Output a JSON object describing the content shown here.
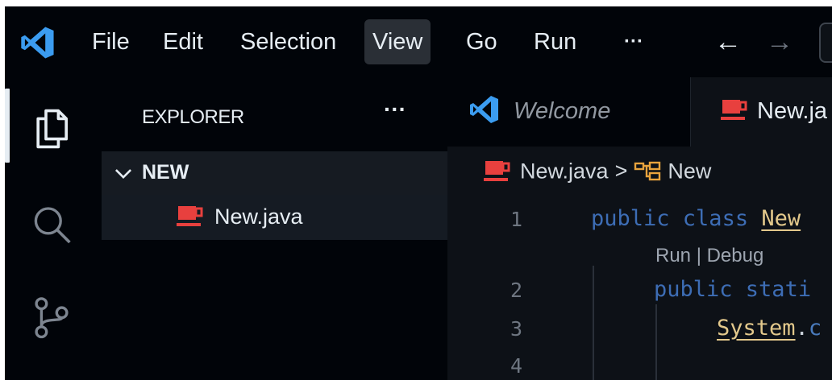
{
  "menu": {
    "items": [
      "File",
      "Edit",
      "Selection",
      "View",
      "Go",
      "Run"
    ],
    "more": "···",
    "active": "View",
    "back_arrow": "←",
    "forward_arrow": "→"
  },
  "sidebar": {
    "title": "EXPLORER",
    "more": "···",
    "folder": {
      "name": "NEW",
      "expanded": true
    },
    "files": [
      {
        "name": "New.java",
        "icon": "java-coffee-icon"
      }
    ]
  },
  "tabs": [
    {
      "label": "Welcome",
      "icon": "vscode-logo-icon",
      "active": false
    },
    {
      "label": "New.ja",
      "icon": "java-coffee-icon",
      "active": true
    }
  ],
  "breadcrumb": {
    "file": "New.java",
    "separator": ">",
    "symbol": "New"
  },
  "editor": {
    "codelens": "Run | Debug",
    "lines": [
      {
        "number": "1",
        "tokens": [
          "public ",
          "class ",
          "New"
        ]
      },
      {
        "number": "2",
        "tokens": [
          "public ",
          "stati"
        ]
      },
      {
        "number": "3",
        "tokens": [
          "System",
          ".",
          "c"
        ]
      },
      {
        "number": "4",
        "tokens": []
      }
    ]
  },
  "colors": {
    "background": "#010409",
    "editor_background": "#0d1117",
    "java_icon": "#e8403e",
    "vscode_blue": "#3b9cf0",
    "keyword": "#3d6db5",
    "class_name": "#e3c98c"
  }
}
